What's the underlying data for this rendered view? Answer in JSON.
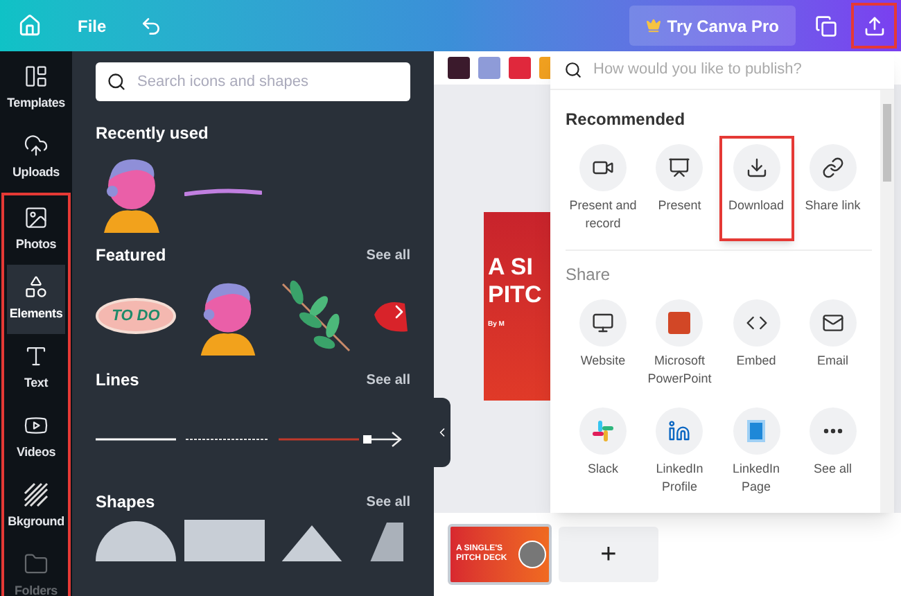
{
  "top_bar": {
    "file_menu": "File",
    "pro_button": "Try Canva Pro",
    "share_highlighted": true
  },
  "sidebar": {
    "items": [
      {
        "label": "Templates",
        "selected": false,
        "highlighted": false
      },
      {
        "label": "Uploads",
        "selected": false,
        "highlighted": false
      },
      {
        "label": "Photos",
        "selected": false,
        "highlighted": true
      },
      {
        "label": "Elements",
        "selected": true,
        "highlighted": true
      },
      {
        "label": "Text",
        "selected": false,
        "highlighted": true
      },
      {
        "label": "Videos",
        "selected": false,
        "highlighted": true
      },
      {
        "label": "Bkground",
        "selected": false,
        "highlighted": true
      },
      {
        "label": "Folders",
        "selected": false,
        "highlighted": true
      }
    ]
  },
  "panel": {
    "search": {
      "placeholder": "Search icons and shapes"
    },
    "sections": [
      {
        "title": "Recently used",
        "kind": "recent"
      },
      {
        "title": "Featured",
        "see_all": "See all",
        "kind": "featured",
        "sticker_text": "TO DO"
      },
      {
        "title": "Lines",
        "see_all": "See all",
        "kind": "lines"
      },
      {
        "title": "Shapes",
        "see_all": "See all",
        "kind": "shapes"
      }
    ]
  },
  "canvas": {
    "swatches": [
      {
        "color": "#3b1a2c"
      },
      {
        "color": "#8e9bd8"
      },
      {
        "color": "#e0283c"
      },
      {
        "color": "#f0a020"
      }
    ],
    "slide": {
      "title_lines": [
        "A SI",
        "PITC"
      ],
      "byline": "By M"
    },
    "thumbnail": {
      "title_lines": [
        "A SINGLE'S",
        "PITCH DECK"
      ],
      "selected": true
    },
    "add_page": "+"
  },
  "publish_menu": {
    "search": {
      "placeholder": "How would you like to publish?"
    },
    "groups": [
      {
        "title": "Recommended",
        "options": [
          {
            "label": "Present and record",
            "highlighted": false
          },
          {
            "label": "Present",
            "highlighted": false
          },
          {
            "label": "Download",
            "highlighted": true
          },
          {
            "label": "Share link",
            "highlighted": false
          }
        ]
      },
      {
        "title": "Share",
        "options": [
          {
            "label": "Website",
            "highlighted": false
          },
          {
            "label": "Microsoft PowerPoint",
            "highlighted": false
          },
          {
            "label": "Embed",
            "highlighted": false
          },
          {
            "label": "Email",
            "highlighted": false
          },
          {
            "label": "Slack",
            "highlighted": false
          },
          {
            "label": "LinkedIn Profile",
            "highlighted": false
          },
          {
            "label": "LinkedIn Page",
            "highlighted": false
          },
          {
            "label": "See all",
            "highlighted": false
          }
        ]
      }
    ]
  }
}
